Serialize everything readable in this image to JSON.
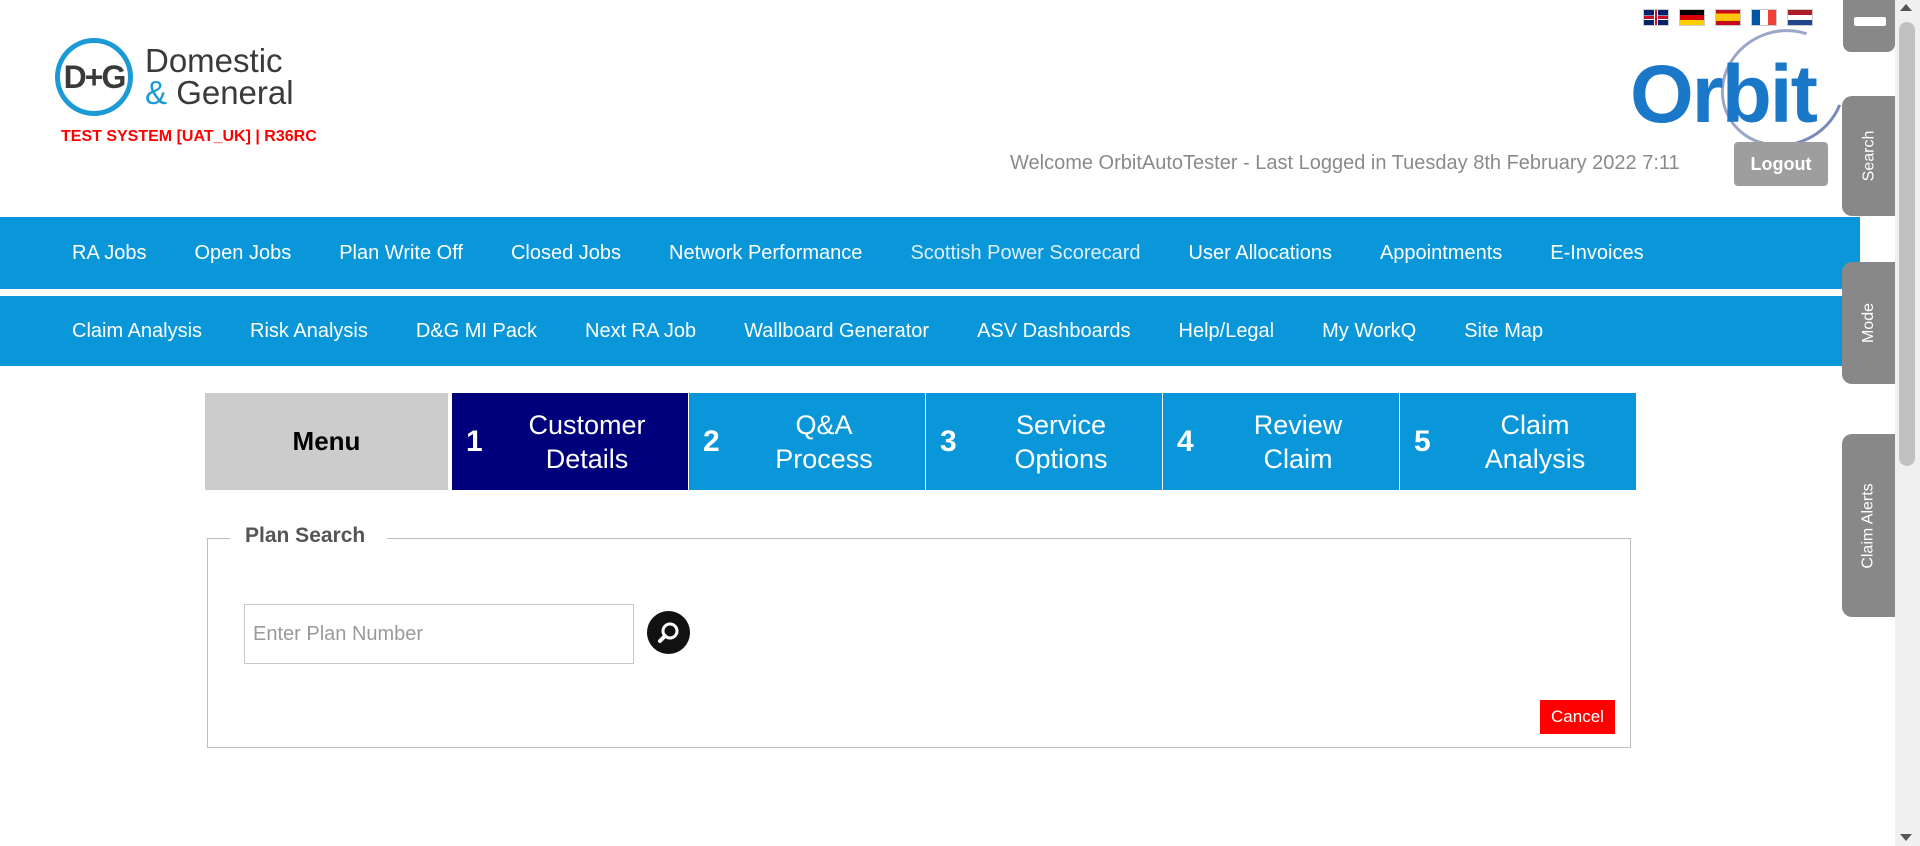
{
  "header": {
    "logo_mark": "D+G",
    "logo_line1": "Domestic",
    "logo_amp": "&",
    "logo_line2": "General",
    "test_system": "TEST SYSTEM [UAT_UK] | R36RC",
    "orbit_logo": "Orbit",
    "welcome": "Welcome OrbitAutoTester - Last Logged in Tuesday 8th February 2022 7:11",
    "logout_label": "Logout",
    "flags": [
      "flag-uk-icon",
      "flag-de-icon",
      "flag-es-icon",
      "flag-fr-icon",
      "flag-nl-icon"
    ]
  },
  "nav1": {
    "items": [
      "RA Jobs",
      "Open Jobs",
      "Plan Write Off",
      "Closed Jobs",
      "Network Performance",
      "Scottish Power Scorecard",
      "User Allocations",
      "Appointments",
      "E-Invoices"
    ]
  },
  "nav2": {
    "items": [
      "Claim Analysis",
      "Risk Analysis",
      "D&G MI Pack",
      "Next RA Job",
      "Wallboard Generator",
      "ASV Dashboards",
      "Help/Legal",
      "My WorkQ",
      "Site Map"
    ]
  },
  "steps": {
    "menu_label": "Menu",
    "items": [
      {
        "num": "1",
        "line1": "Customer",
        "line2": "Details"
      },
      {
        "num": "2",
        "line1": "Q&A",
        "line2": "Process"
      },
      {
        "num": "3",
        "line1": "Service",
        "line2": "Options"
      },
      {
        "num": "4",
        "line1": "Review",
        "line2": "Claim"
      },
      {
        "num": "5",
        "line1": "Claim",
        "line2": "Analysis"
      }
    ]
  },
  "plan_search": {
    "legend": "Plan Search",
    "input_placeholder": "Enter Plan Number",
    "input_value": "",
    "search_icon": "search-icon",
    "cancel_label": "Cancel"
  },
  "side_tabs": {
    "search": "Search",
    "mode": "Mode",
    "alerts": "Claim Alerts"
  },
  "colors": {
    "nav_blue": "#0a97da",
    "active_step": "#00007d",
    "test_red": "#ff0000",
    "side_tab_grey": "#888888"
  }
}
